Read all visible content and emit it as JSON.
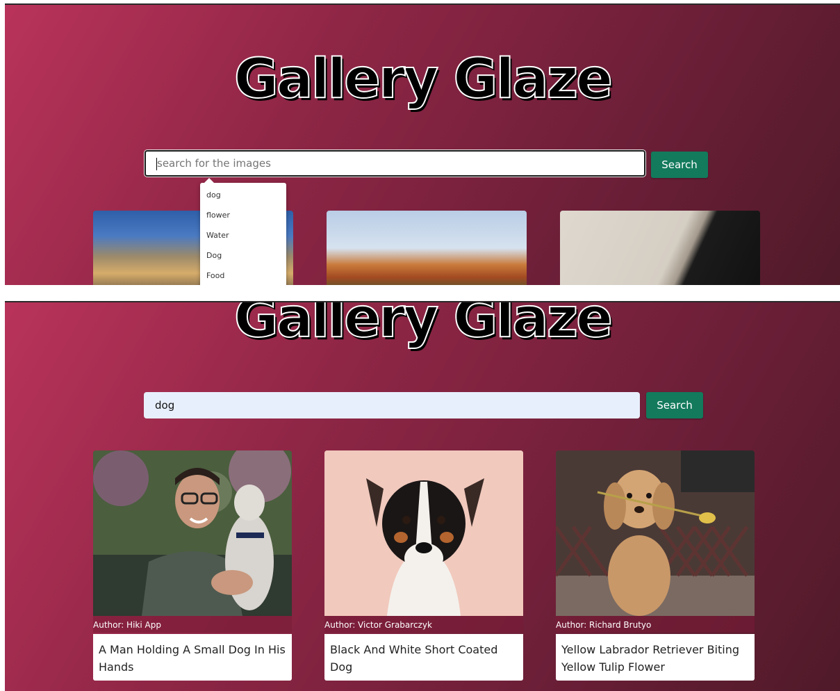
{
  "app": {
    "title": "Gallery Glaze"
  },
  "top_view": {
    "search": {
      "placeholder": "search for the images",
      "button_label": "Search"
    },
    "suggestions": [
      "dog",
      "flower",
      "Water",
      "Dog",
      "Food"
    ]
  },
  "bottom_view": {
    "search": {
      "value": "dog",
      "button_label": "Search"
    },
    "results": [
      {
        "author": "Author: Hiki App",
        "description": "A Man Holding A Small Dog In His Hands"
      },
      {
        "author": "Author: Victor Grabarczyk",
        "description": "Black And White Short Coated Dog"
      },
      {
        "author": "Author: Richard Brutyo",
        "description": "Yellow Labrador Retriever Biting Yellow Tulip Flower"
      }
    ]
  },
  "colors": {
    "accent": "#137a5c",
    "background_start": "#b9335a",
    "background_end": "#4f1a29"
  }
}
